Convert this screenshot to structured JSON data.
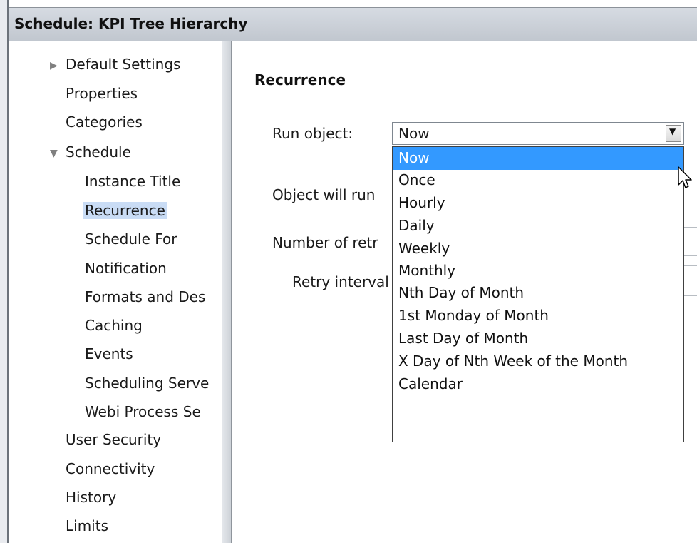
{
  "window": {
    "title": "Schedule: KPI Tree Hierarchy"
  },
  "nav": {
    "items": [
      {
        "label": "Default Settings",
        "level": 1,
        "expander": "collapsed"
      },
      {
        "label": "Properties",
        "level": 1
      },
      {
        "label": "Categories",
        "level": 1
      },
      {
        "label": "Schedule",
        "level": 1,
        "expander": "expanded"
      },
      {
        "label": "Instance Title",
        "level": 2
      },
      {
        "label": "Recurrence",
        "level": 2,
        "selected": true
      },
      {
        "label": "Schedule For",
        "level": 2
      },
      {
        "label": "Notification",
        "level": 2
      },
      {
        "label": "Formats and Des",
        "level": 2
      },
      {
        "label": "Caching",
        "level": 2
      },
      {
        "label": "Events",
        "level": 2
      },
      {
        "label": "Scheduling Serve",
        "level": 2
      },
      {
        "label": "Webi Process Se",
        "level": 2
      },
      {
        "label": "User Security",
        "level": 1
      },
      {
        "label": "Connectivity",
        "level": 1
      },
      {
        "label": "History",
        "level": 1
      },
      {
        "label": "Limits",
        "level": 1
      }
    ]
  },
  "content": {
    "heading": "Recurrence",
    "run_object_label": "Run object:",
    "run_object_value": "Now",
    "object_will_run_label": "Object will run",
    "number_of_retries_label": "Number of retr",
    "retry_interval_label": "Retry interval",
    "options": [
      "Now",
      "Once",
      "Hourly",
      "Daily",
      "Weekly",
      "Monthly",
      "Nth Day of Month",
      "1st Monday of Month",
      "Last Day of Month",
      "X Day of Nth Week of the Month",
      "Calendar"
    ],
    "highlighted_option": "Now"
  },
  "icons": {
    "collapsed": "triangle-right-icon",
    "expanded": "triangle-down-icon",
    "dropdown": "chevron-down-icon",
    "cursor": "mouse-pointer-icon"
  },
  "colors": {
    "highlight": "#3399ff",
    "selected_nav": "#c9dcf5",
    "titlebar": "#c8cdd4"
  }
}
